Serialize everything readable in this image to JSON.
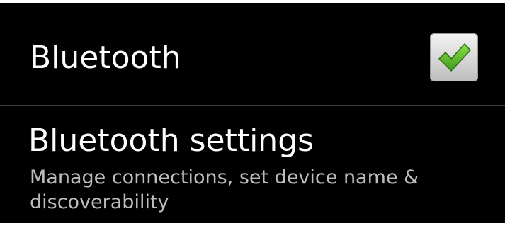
{
  "bluetooth_toggle": {
    "label": "Bluetooth",
    "checked": true,
    "check_color": "#4caf2a"
  },
  "bluetooth_settings": {
    "title": "Bluetooth settings",
    "summary": "Manage connections, set device name & discoverability"
  },
  "colors": {
    "background": "#000000",
    "primary_text": "#ffffff",
    "secondary_text": "#bdbdbd",
    "divider": "#3c3c3c"
  }
}
